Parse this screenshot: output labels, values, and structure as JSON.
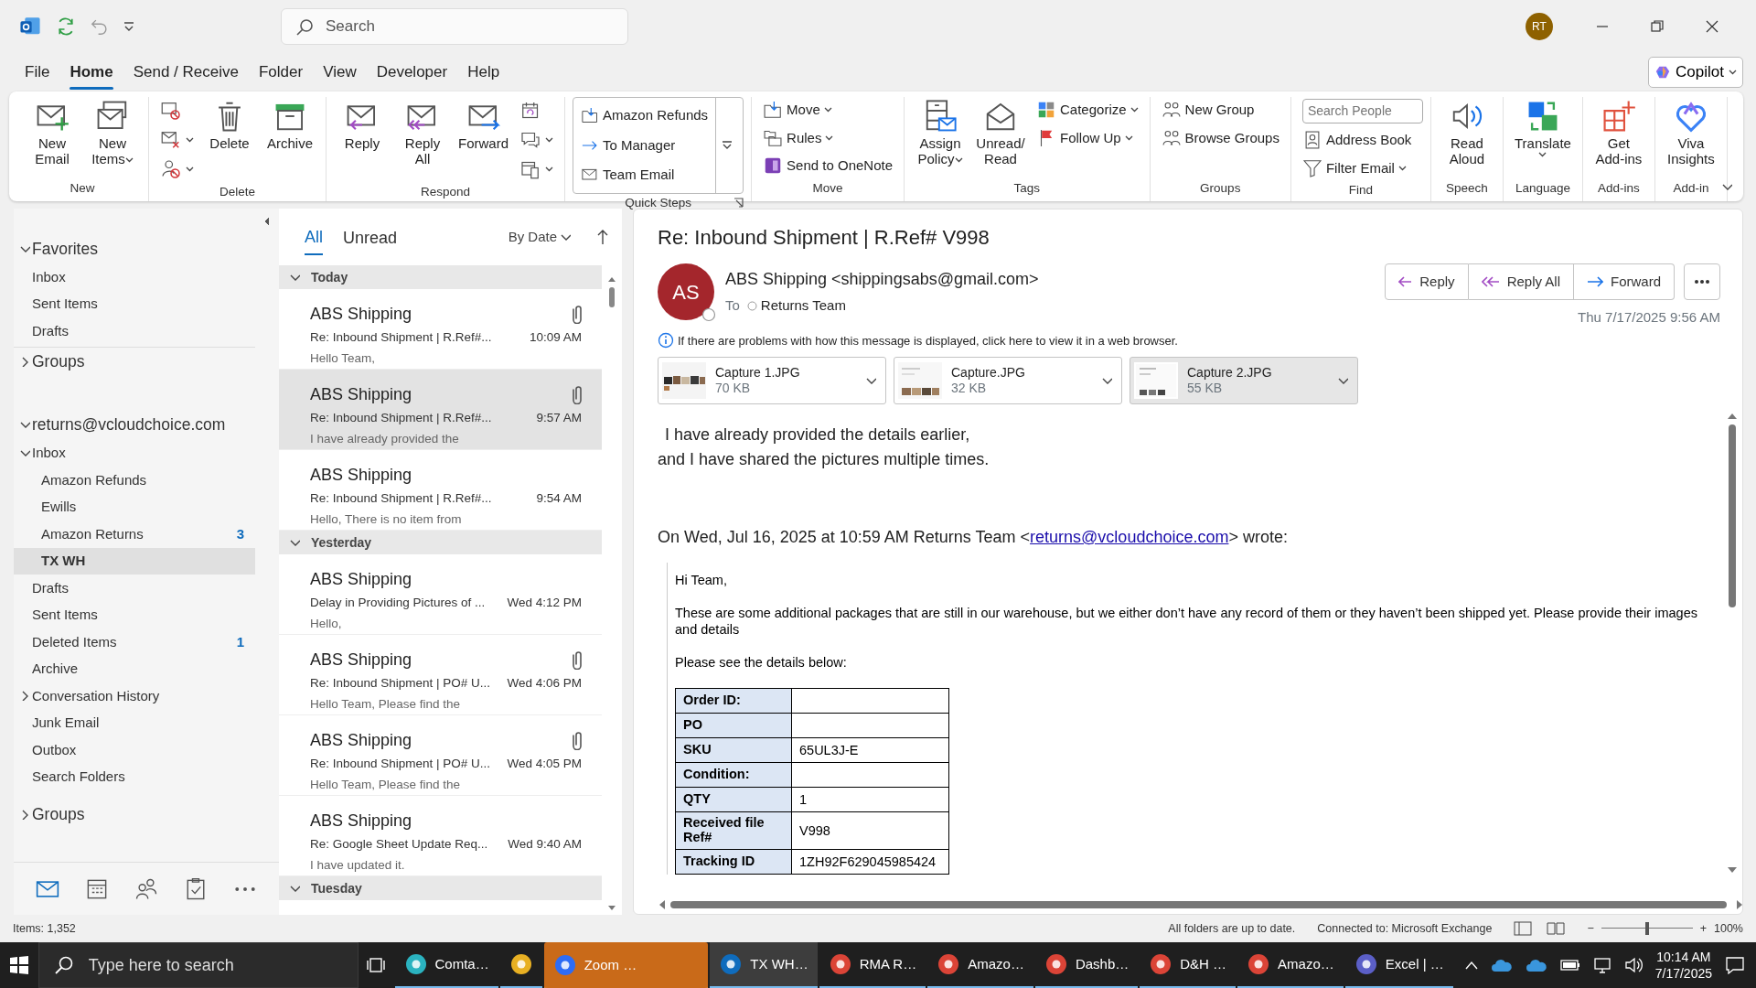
{
  "title_bar": {
    "search_placeholder": "Search",
    "avatar": "RT"
  },
  "menu_tabs": [
    {
      "label": "File",
      "selected": false
    },
    {
      "label": "Home",
      "selected": true
    },
    {
      "label": "Send / Receive",
      "selected": false
    },
    {
      "label": "Folder",
      "selected": false
    },
    {
      "label": "View",
      "selected": false
    },
    {
      "label": "Developer",
      "selected": false
    },
    {
      "label": "Help",
      "selected": false
    }
  ],
  "copilot": "Copilot",
  "ribbon": [
    {
      "label": "New",
      "items": [
        {
          "kind": "large",
          "label": "New Email",
          "dropdown": false
        },
        {
          "kind": "large",
          "label": "New Items",
          "dropdown": true
        }
      ]
    },
    {
      "label": "Delete",
      "items": [
        {
          "kind": "small",
          "dropdown": false
        },
        {
          "kind": "small",
          "dropdown": true
        },
        {
          "kind": "small",
          "dropdown": true
        },
        {
          "kind": "large",
          "label": "Delete",
          "dropdown": false
        },
        {
          "kind": "large",
          "label": "Archive",
          "dropdown": false
        }
      ]
    },
    {
      "label": "Respond",
      "items": [
        {
          "kind": "large",
          "label": "Reply",
          "dropdown": false
        },
        {
          "kind": "large",
          "label": "Reply All",
          "dropdown": false
        },
        {
          "kind": "large",
          "label": "Forward",
          "dropdown": false
        },
        {
          "kind": "small",
          "dropdown": false
        },
        {
          "kind": "small",
          "dropdown": true
        },
        {
          "kind": "small",
          "dropdown": true
        }
      ]
    },
    {
      "label": "Quick Steps",
      "launcher": true,
      "items": [
        {
          "kind": "step",
          "label": "Amazon Refunds"
        },
        {
          "kind": "step",
          "label": "To Manager"
        },
        {
          "kind": "step",
          "label": "Team Email"
        }
      ]
    },
    {
      "label": "Move",
      "items": [
        {
          "kind": "small",
          "label": "Move",
          "dropdown": true
        },
        {
          "kind": "small",
          "label": "Rules",
          "dropdown": true
        },
        {
          "kind": "small",
          "label": "Send to OneNote",
          "dropdown": false
        }
      ]
    },
    {
      "label": "Tags",
      "items": [
        {
          "kind": "large",
          "label": "Assign Policy",
          "dropdown": true
        },
        {
          "kind": "large",
          "label": "Unread/ Read",
          "dropdown": false
        },
        {
          "kind": "small",
          "label": "Categorize",
          "dropdown": true
        },
        {
          "kind": "small",
          "label": "Follow Up",
          "dropdown": true
        }
      ]
    },
    {
      "label": "Groups",
      "items": [
        {
          "kind": "small",
          "label": "New Group",
          "dropdown": false
        },
        {
          "kind": "small",
          "label": "Browse Groups",
          "dropdown": false
        }
      ]
    },
    {
      "label": "Find",
      "items": [
        {
          "kind": "field",
          "placeholder": "Search People"
        },
        {
          "kind": "small",
          "label": "Address Book",
          "dropdown": false
        },
        {
          "kind": "small",
          "label": "Filter Email",
          "dropdown": true
        }
      ]
    },
    {
      "label": "Speech",
      "items": [
        {
          "kind": "large",
          "label": "Read Aloud",
          "dropdown": false
        }
      ]
    },
    {
      "label": "Language",
      "items": [
        {
          "kind": "large",
          "label": "Translate",
          "dropdown": true
        }
      ]
    },
    {
      "label": "Add-ins",
      "items": [
        {
          "kind": "large",
          "label": "Get Add-ins",
          "dropdown": false
        }
      ]
    },
    {
      "label": "Add-in",
      "items": [
        {
          "kind": "large",
          "label": "Viva Insights",
          "dropdown": false
        }
      ]
    }
  ],
  "folders": [
    {
      "label": "Favorites",
      "expanded": true,
      "selected": false,
      "children": [
        {
          "label": "Inbox",
          "selected": false
        },
        {
          "label": "Sent Items",
          "selected": false
        },
        {
          "label": "Drafts",
          "selected": false
        }
      ]
    },
    {
      "label": "Groups",
      "expanded": false,
      "selected": false
    },
    {
      "label": "returns@vcloudchoice.com",
      "expanded": true,
      "selected": false,
      "children": [
        {
          "label": "Inbox",
          "expanded": true,
          "selected": false,
          "children": [
            {
              "label": "Amazon Refunds",
              "selected": false
            },
            {
              "label": "Ewills",
              "selected": false
            },
            {
              "label": "Amazon Returns",
              "count": "3",
              "selected": false
            },
            {
              "label": "TX WH",
              "selected": true
            }
          ]
        },
        {
          "label": "Drafts",
          "selected": false
        },
        {
          "label": "Sent Items",
          "selected": false
        },
        {
          "label": "Deleted Items",
          "count": "1",
          "selected": false
        },
        {
          "label": "Archive",
          "selected": false
        },
        {
          "label": "Conversation History",
          "expanded": false,
          "selected": false
        },
        {
          "label": "Junk Email",
          "selected": false
        },
        {
          "label": "Outbox",
          "selected": false
        },
        {
          "label": "Search Folders",
          "selected": false
        }
      ]
    },
    {
      "label": "Groups",
      "expanded": false,
      "selected": false
    }
  ],
  "nav_modules": [
    {
      "selected": true
    },
    {
      "selected": false
    },
    {
      "selected": false
    },
    {
      "selected": false
    },
    {
      "selected": false
    }
  ],
  "message_list": {
    "filters": [
      {
        "label": "All",
        "selected": true
      },
      {
        "label": "Unread",
        "selected": false
      }
    ],
    "sort": "By Date",
    "groups": [
      {
        "label": "Today",
        "expanded": true,
        "messages": [
          {
            "sender": "ABS Shipping",
            "subject": "Re: Inbound Shipment | R.Ref#...",
            "preview": "Hello Team,",
            "time": "10:09 AM",
            "attachment": true,
            "selected": false
          },
          {
            "sender": "ABS Shipping",
            "subject": "Re: Inbound Shipment | R.Ref#...",
            "preview": "I have already provided the",
            "time": "9:57 AM",
            "attachment": true,
            "selected": true
          },
          {
            "sender": "ABS Shipping",
            "subject": "Re: Inbound Shipment | R.Ref#...",
            "preview": "Hello,  There is no item from",
            "time": "9:54 AM",
            "attachment": false,
            "selected": false
          }
        ]
      },
      {
        "label": "Yesterday",
        "expanded": true,
        "messages": [
          {
            "sender": "ABS Shipping",
            "subject": "Delay in Providing Pictures of ...",
            "preview": "Hello,",
            "time": "Wed 4:12 PM",
            "attachment": false,
            "selected": false
          },
          {
            "sender": "ABS Shipping",
            "subject": "Re: Inbound Shipment | PO# U...",
            "preview": "Hello Team,  Please find the",
            "time": "Wed 4:06 PM",
            "attachment": true,
            "selected": false
          },
          {
            "sender": "ABS Shipping",
            "subject": "Re: Inbound Shipment | PO# U...",
            "preview": "Hello Team,  Please find the",
            "time": "Wed 4:05 PM",
            "attachment": true,
            "selected": false
          },
          {
            "sender": "ABS Shipping",
            "subject": "Re: Google Sheet Update Req...",
            "preview": "I have updated it.",
            "time": "Wed 9:40 AM",
            "attachment": false,
            "selected": false
          }
        ]
      },
      {
        "label": "Tuesday",
        "expanded": true
      }
    ]
  },
  "reading_pane": {
    "subject": "Re: Inbound Shipment | R.Ref# V998",
    "avatar": "AS",
    "sender": "ABS Shipping <shippingsabs@gmail.com>",
    "to_label": "To",
    "recipient": "Returns Team",
    "date": "Thu 7/17/2025 9:56 AM",
    "actions": [
      "Reply",
      "Reply All",
      "Forward"
    ],
    "info": "If there are problems with how this message is displayed, click here to view it in a web browser.",
    "attachments": [
      {
        "name": "Capture 1.JPG",
        "size": "70 KB",
        "selected": false
      },
      {
        "name": "Capture.JPG",
        "size": "32 KB",
        "selected": false
      },
      {
        "name": "Capture 2.JPG",
        "size": "55 KB",
        "selected": true
      }
    ],
    "body": [
      "I have already provided the details earlier,",
      "and I have shared the pictures multiple times."
    ],
    "quote_header": {
      "before": "On Wed, Jul 16, 2025 at 10:59 AM Returns Team <",
      "link": "returns@vcloudchoice.com",
      "after": "> wrote:"
    },
    "quote": [
      "Hi Team,",
      "These are some additional packages that are still in our warehouse, but we either don’t have any record of them or they haven’t been shipped yet. Please provide their images and details",
      "Please see the details below:"
    ],
    "table": [
      {
        "label": "Order ID:"
      },
      {
        "label": "PO"
      },
      {
        "label": "SKU",
        "value": "65UL3J-E"
      },
      {
        "label": "Condition:"
      },
      {
        "label": "QTY",
        "value": "1"
      },
      {
        "label": "Received file Ref#",
        "value": "V998"
      },
      {
        "label": "Tracking ID",
        "value": "1ZH92F629045985424"
      }
    ]
  },
  "status_bar": {
    "items": "Items: 1,352",
    "sync": "All folders are up to date.",
    "connection": "Connected to: Microsoft Exchange",
    "zoom_out": "−",
    "zoom_in": "+",
    "zoom_slider": {
      "level": 0.5
    },
    "zoom": "100%"
  },
  "taskbar": {
    "search_placeholder": "Type here to search",
    "apps": [
      {
        "label": "Comta…",
        "color": "#2bb3c0",
        "selected": false,
        "attention": false
      },
      {
        "color": "#e8b023",
        "selected": false,
        "attention": false
      },
      {
        "label": "Zoom …",
        "color": "#2d6cf5",
        "selected": false,
        "attention": true
      },
      {
        "label": "TX WH…",
        "color": "#0f6cbd",
        "selected": true,
        "attention": false
      },
      {
        "label": "RMA R…",
        "color": "#db4437",
        "selected": false,
        "attention": false
      },
      {
        "label": "Amazo…",
        "color": "#db4437",
        "selected": false,
        "attention": false
      },
      {
        "label": "Dashb…",
        "color": "#db4437",
        "selected": false,
        "attention": false
      },
      {
        "label": "D&H …",
        "color": "#db4437",
        "selected": false,
        "attention": false
      },
      {
        "label": "Amazo…",
        "color": "#db4437",
        "selected": false,
        "attention": false
      },
      {
        "label": "Excel | …",
        "color": "#5b5fc7",
        "selected": false,
        "attention": false
      }
    ],
    "time": "10:14 AM",
    "date": "7/17/2025"
  }
}
